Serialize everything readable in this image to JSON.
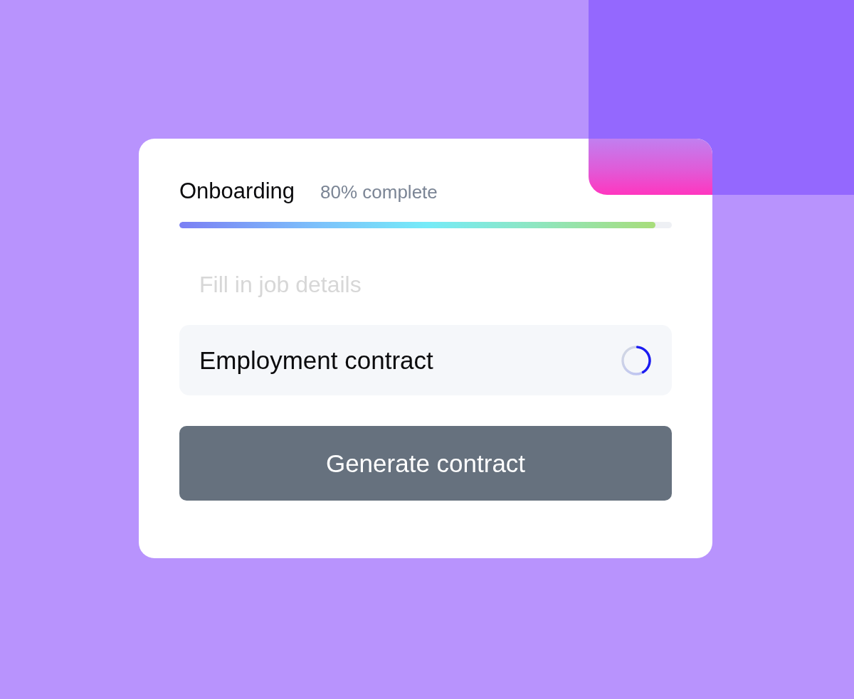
{
  "progress": {
    "title": "Onboarding",
    "caption": "80% complete",
    "level": 0.967
  },
  "steps": [
    {
      "label": "Fill in job details",
      "kind": "past"
    },
    {
      "label": "Employment contract",
      "kind": "current"
    }
  ],
  "button": {
    "label": "Generate contract"
  }
}
